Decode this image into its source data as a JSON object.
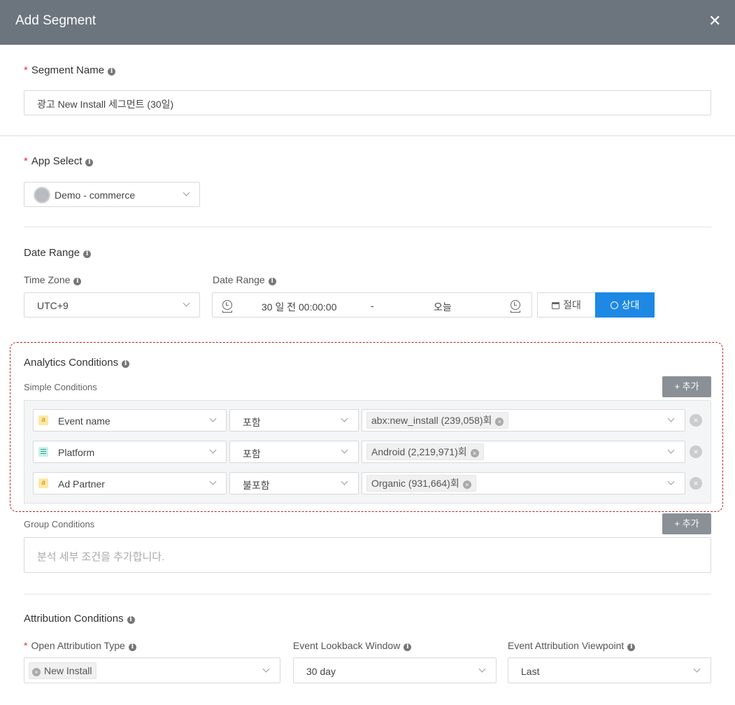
{
  "modal": {
    "title": "Add Segment",
    "close_glyph": "✕"
  },
  "segment_name": {
    "label": "Segment Name",
    "value": "광고 New Install 세그먼트 (30일)"
  },
  "app_select": {
    "label": "App Select",
    "value": "Demo - commerce"
  },
  "date_range_section": {
    "title": "Date Range",
    "timezone_label": "Time Zone",
    "timezone_value": "UTC+9",
    "range_label": "Date Range",
    "start": "30 일 전 00:00:00",
    "separator": "-",
    "end": "오늘",
    "absolute_label": "절대",
    "relative_label": "상대",
    "active_color": "#1e88e5"
  },
  "analytics": {
    "title": "Analytics Conditions",
    "simple_label": "Simple Conditions",
    "add_label": "+ 추가",
    "conditions": [
      {
        "type_icon": "a",
        "field": "Event name",
        "operator": "포함",
        "value": "abx:new_install (239,058)회"
      },
      {
        "type_icon": "list",
        "field": "Platform",
        "operator": "포함",
        "value": "Android (2,219,971)회"
      },
      {
        "type_icon": "a",
        "field": "Ad Partner",
        "operator": "불포함",
        "value": "Organic (931,664)회"
      }
    ],
    "group_label": "Group Conditions",
    "group_add_label": "+ 추가",
    "group_placeholder": "분석 세부 조건을 추가합니다."
  },
  "attribution": {
    "title": "Attribution Conditions",
    "open_type_label": "Open Attribution Type",
    "open_type_tag": "New Install",
    "lookback_label": "Event Lookback Window",
    "lookback_value": "30 day",
    "viewpoint_label": "Event Attribution Viewpoint",
    "viewpoint_value": "Last"
  },
  "icons": {
    "info": "i",
    "tag_remove": "×",
    "row_remove": "×"
  },
  "colors": {
    "header_bg": "#6c757d",
    "required": "#e0343c",
    "highlight_border": "#b22222"
  }
}
